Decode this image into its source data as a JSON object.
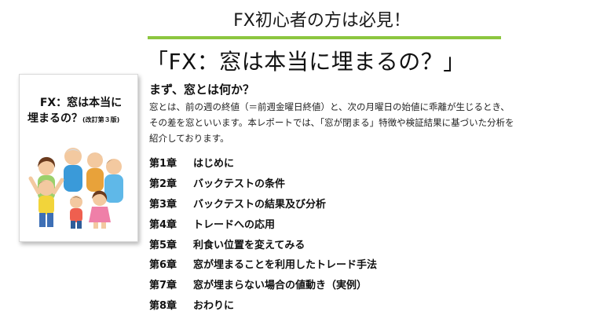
{
  "header": {
    "subtitle": "FX初心者の方は必見！",
    "title": "「FX：窓は本当に埋まるの？」"
  },
  "book": {
    "title_line1": "FX：窓は本当に",
    "title_line2": "埋まるの？",
    "edition": "(改訂第３版)"
  },
  "intro": {
    "heading": "まず、窓とは何か？",
    "lines": [
      "窓とは、前の週の終値（＝前週金曜日終値）と、次の月曜日の始値に乖離が生じるとき、",
      "その差を窓といいます。本レポートでは､「窓が閉まる」特徴や検証結果に基づいた分析を",
      "紹介しております。"
    ]
  },
  "toc": [
    {
      "num": "第1章",
      "title": "はじめに"
    },
    {
      "num": "第2章",
      "title": "バックテストの条件"
    },
    {
      "num": "第3章",
      "title": "バックテストの結果及び分析"
    },
    {
      "num": "第4章",
      "title": "トレードへの応用"
    },
    {
      "num": "第5章",
      "title": "利食い位置を変えてみる"
    },
    {
      "num": "第6章",
      "title": "窓が埋まることを利用したトレード手法"
    },
    {
      "num": "第7章",
      "title": "窓が埋まらない場合の値動き（実例）"
    },
    {
      "num": "第8章",
      "title": "おわりに"
    }
  ]
}
